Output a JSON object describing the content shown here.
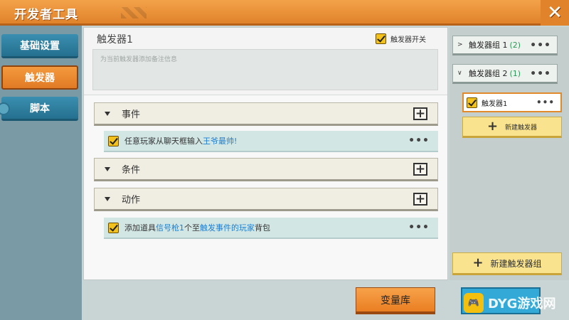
{
  "window": {
    "title": "开发者工具"
  },
  "sidebar": {
    "items": [
      {
        "label": "基础设置"
      },
      {
        "label": "触发器"
      },
      {
        "label": "脚本"
      }
    ]
  },
  "trigger": {
    "name": "触发器1",
    "switch_label": "触发器开关",
    "note_placeholder": "为当前触发器添加备注信息"
  },
  "sections": {
    "event": {
      "label": "事件",
      "rule_prefix": "任意玩家从聊天框输入",
      "rule_highlight": "王爷最帅!"
    },
    "condition": {
      "label": "条件"
    },
    "action": {
      "label": "动作",
      "rule_part1": "添加道具",
      "rule_hl1": "信号枪1",
      "rule_part2": "个至",
      "rule_hl2": "触发事件的玩家",
      "rule_part3": "背包"
    }
  },
  "groups": [
    {
      "label": "触发器组 1",
      "count": "(2)",
      "expanded": false
    },
    {
      "label": "触发器组 2",
      "count": "(1)",
      "expanded": true
    }
  ],
  "group_items": [
    {
      "label": "触发器1"
    }
  ],
  "buttons": {
    "new_trigger": "新建触发器",
    "new_group": "新建触发器组",
    "variables": "变量库"
  },
  "watermark": {
    "text": "DYG游戏网"
  },
  "colors": {
    "accent_orange": "#e0832b",
    "highlight_blue": "#1e7fd0",
    "count_green": "#2a9a55"
  }
}
